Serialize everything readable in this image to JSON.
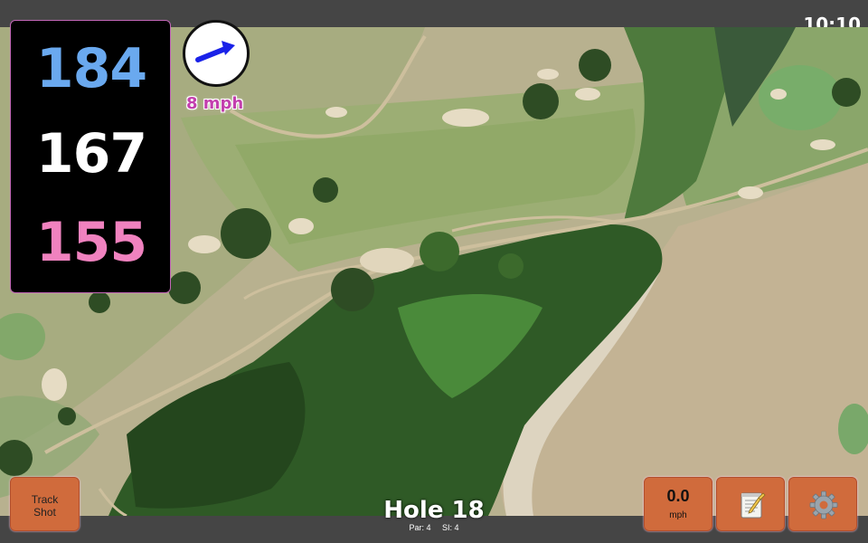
{
  "status": {
    "time": "10:10"
  },
  "distances": {
    "back": "184",
    "middle": "167",
    "front": "155"
  },
  "wind": {
    "speed": "8 mph",
    "direction_icon": "arrow-icon"
  },
  "hole": {
    "title": "Hole 18",
    "par": "Par: 4",
    "stroke_index": "SI: 4"
  },
  "buttons": {
    "track_shot_line1": "Track",
    "track_shot_line2": "Shot",
    "speed_value": "0.0",
    "speed_unit": "mph",
    "notes_icon": "notepad-icon",
    "settings_icon": "gear-icon"
  },
  "colors": {
    "back_distance": "#6aa9ef",
    "middle_distance": "#ffffff",
    "front_distance": "#f082bf",
    "button": "#d06b3c",
    "wind_text": "#c33fae"
  }
}
